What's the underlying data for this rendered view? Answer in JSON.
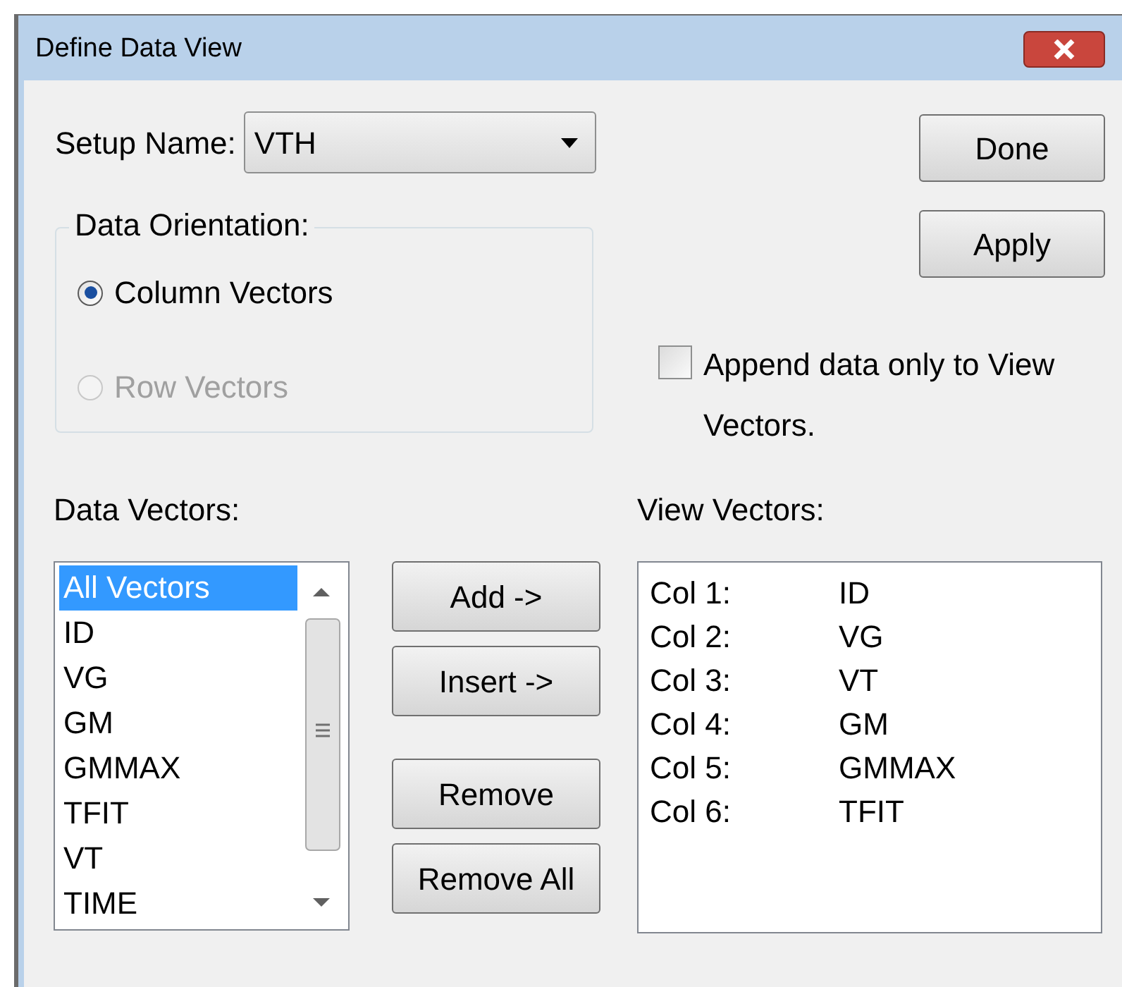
{
  "window": {
    "title": "Define Data View"
  },
  "setup_name": {
    "label": "Setup Name:",
    "value": "VTH"
  },
  "side_buttons": [
    "Done",
    "Apply"
  ],
  "orientation": {
    "label": "Data Orientation:",
    "options": [
      {
        "label": "Column Vectors",
        "selected": true,
        "disabled": false
      },
      {
        "label": "Row Vectors",
        "selected": false,
        "disabled": true
      }
    ]
  },
  "append_option": {
    "label": "Append data only to View Vectors.",
    "checked": false
  },
  "data_vectors": {
    "label": "Data Vectors:",
    "items": [
      {
        "label": "All Vectors",
        "selected": true
      },
      {
        "label": "ID",
        "selected": false
      },
      {
        "label": "VG",
        "selected": false
      },
      {
        "label": "GM",
        "selected": false
      },
      {
        "label": "GMMAX",
        "selected": false
      },
      {
        "label": "TFIT",
        "selected": false
      },
      {
        "label": "VT",
        "selected": false
      },
      {
        "label": "TIME",
        "selected": false
      }
    ]
  },
  "action_buttons": [
    "Add ->",
    "Insert ->",
    "Remove",
    "Remove All"
  ],
  "view_vectors": {
    "label": "View Vectors:",
    "rows": [
      {
        "column": "Col 1:",
        "vector": "ID"
      },
      {
        "column": "Col 2:",
        "vector": "VG"
      },
      {
        "column": "Col 3:",
        "vector": "VT"
      },
      {
        "column": "Col 4:",
        "vector": "GM"
      },
      {
        "column": "Col 5:",
        "vector": "GMMAX"
      },
      {
        "column": "Col 6:",
        "vector": "TFIT"
      }
    ]
  }
}
